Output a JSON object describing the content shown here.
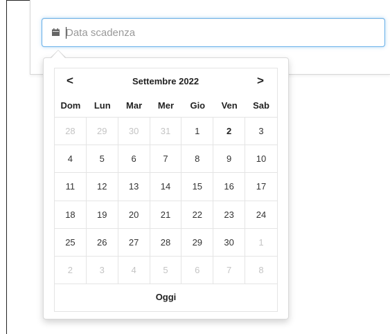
{
  "input": {
    "placeholder": "Data scadenza",
    "value": ""
  },
  "icons": {
    "input_icon": "calendar-icon",
    "prev": "chevron-left-icon",
    "next": "chevron-right-icon"
  },
  "calendar": {
    "prev_label": "<",
    "next_label": ">",
    "month_label": "Settembre 2022",
    "weekdays": [
      "Dom",
      "Lun",
      "Mar",
      "Mer",
      "Gio",
      "Ven",
      "Sab"
    ],
    "weeks": [
      [
        {
          "d": "28",
          "m": true
        },
        {
          "d": "29",
          "m": true
        },
        {
          "d": "30",
          "m": true
        },
        {
          "d": "31",
          "m": true
        },
        {
          "d": "1"
        },
        {
          "d": "2",
          "today": true
        },
        {
          "d": "3"
        }
      ],
      [
        {
          "d": "4"
        },
        {
          "d": "5"
        },
        {
          "d": "6"
        },
        {
          "d": "7"
        },
        {
          "d": "8"
        },
        {
          "d": "9"
        },
        {
          "d": "10"
        }
      ],
      [
        {
          "d": "11"
        },
        {
          "d": "12"
        },
        {
          "d": "13"
        },
        {
          "d": "14"
        },
        {
          "d": "15"
        },
        {
          "d": "16"
        },
        {
          "d": "17"
        }
      ],
      [
        {
          "d": "18"
        },
        {
          "d": "19"
        },
        {
          "d": "20"
        },
        {
          "d": "21"
        },
        {
          "d": "22"
        },
        {
          "d": "23"
        },
        {
          "d": "24"
        }
      ],
      [
        {
          "d": "25"
        },
        {
          "d": "26"
        },
        {
          "d": "27"
        },
        {
          "d": "28"
        },
        {
          "d": "29"
        },
        {
          "d": "30"
        },
        {
          "d": "1",
          "m": true
        }
      ],
      [
        {
          "d": "2",
          "m": true
        },
        {
          "d": "3",
          "m": true
        },
        {
          "d": "4",
          "m": true
        },
        {
          "d": "5",
          "m": true
        },
        {
          "d": "6",
          "m": true
        },
        {
          "d": "7",
          "m": true
        },
        {
          "d": "8",
          "m": true
        }
      ]
    ],
    "today_label": "Oggi"
  },
  "colors": {
    "focus_border": "#66afe9",
    "muted_day": "#c4c4c4",
    "text": "#222222"
  }
}
